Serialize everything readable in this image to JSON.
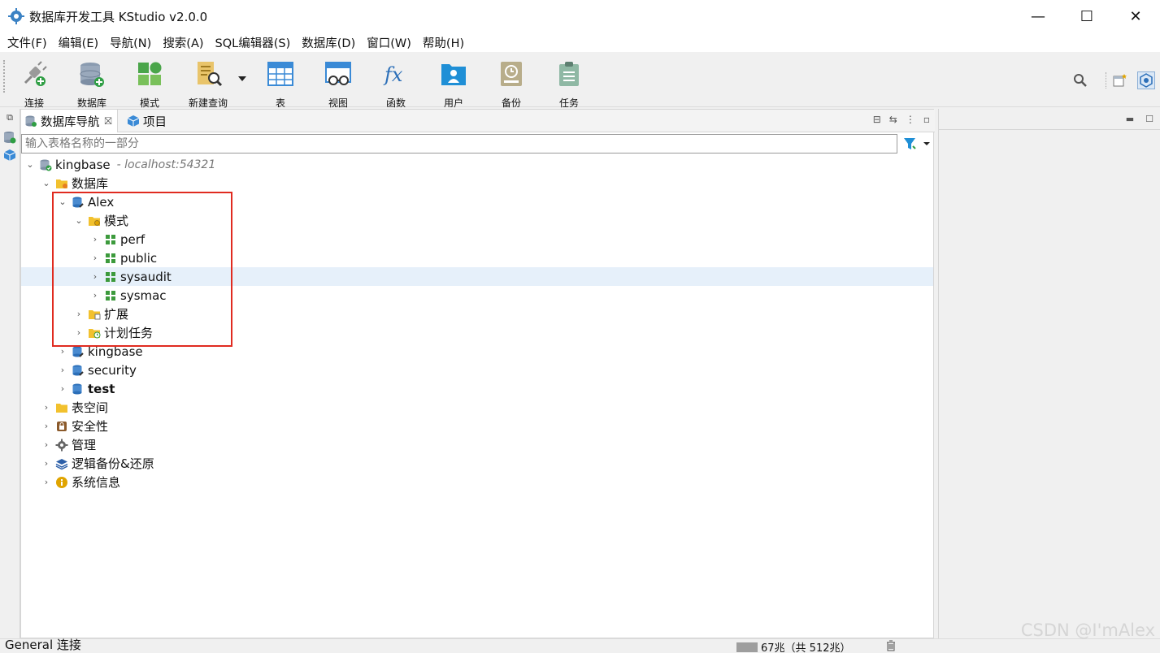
{
  "window": {
    "title": "数据库开发工具 KStudio v2.0.0",
    "minimize": "—",
    "maximize": "☐",
    "close": "✕"
  },
  "menu": [
    "文件(F)",
    "编辑(E)",
    "导航(N)",
    "搜索(A)",
    "SQL编辑器(S)",
    "数据库(D)",
    "窗口(W)",
    "帮助(H)"
  ],
  "toolbar": {
    "connect": "连接",
    "database": "数据库",
    "schema": "模式",
    "new_query": "新建查询",
    "table": "表",
    "view": "视图",
    "function": "函数",
    "user": "用户",
    "backup": "备份",
    "task": "任务"
  },
  "nav": {
    "tab_active": "数据库导航",
    "tab_project": "项目",
    "filter_placeholder": "输入表格名称的一部分"
  },
  "tree": {
    "root": "kingbase",
    "root_host": "- localhost:54321",
    "databases_folder": "数据库",
    "db_alex": "Alex",
    "schemas_folder": "模式",
    "schemas": [
      "perf",
      "public",
      "sysaudit",
      "sysmac"
    ],
    "extensions": "扩展",
    "scheduled_tasks": "计划任务",
    "db_kingbase": "kingbase",
    "db_security": "security",
    "db_test": "test",
    "tablespaces": "表空间",
    "security": "安全性",
    "management": "管理",
    "logical_backup": "逻辑备份&还原",
    "system_info": "系统信息"
  },
  "status": {
    "left": "General 连接",
    "memory": "67兆（共 512兆）"
  },
  "watermark": "CSDN @I'mAlex",
  "colors": {
    "highlight_box": "#e02b20",
    "selection": "#e6f0fa",
    "schema_icon": "#3c9a3c",
    "folder": "#f2c12e"
  }
}
